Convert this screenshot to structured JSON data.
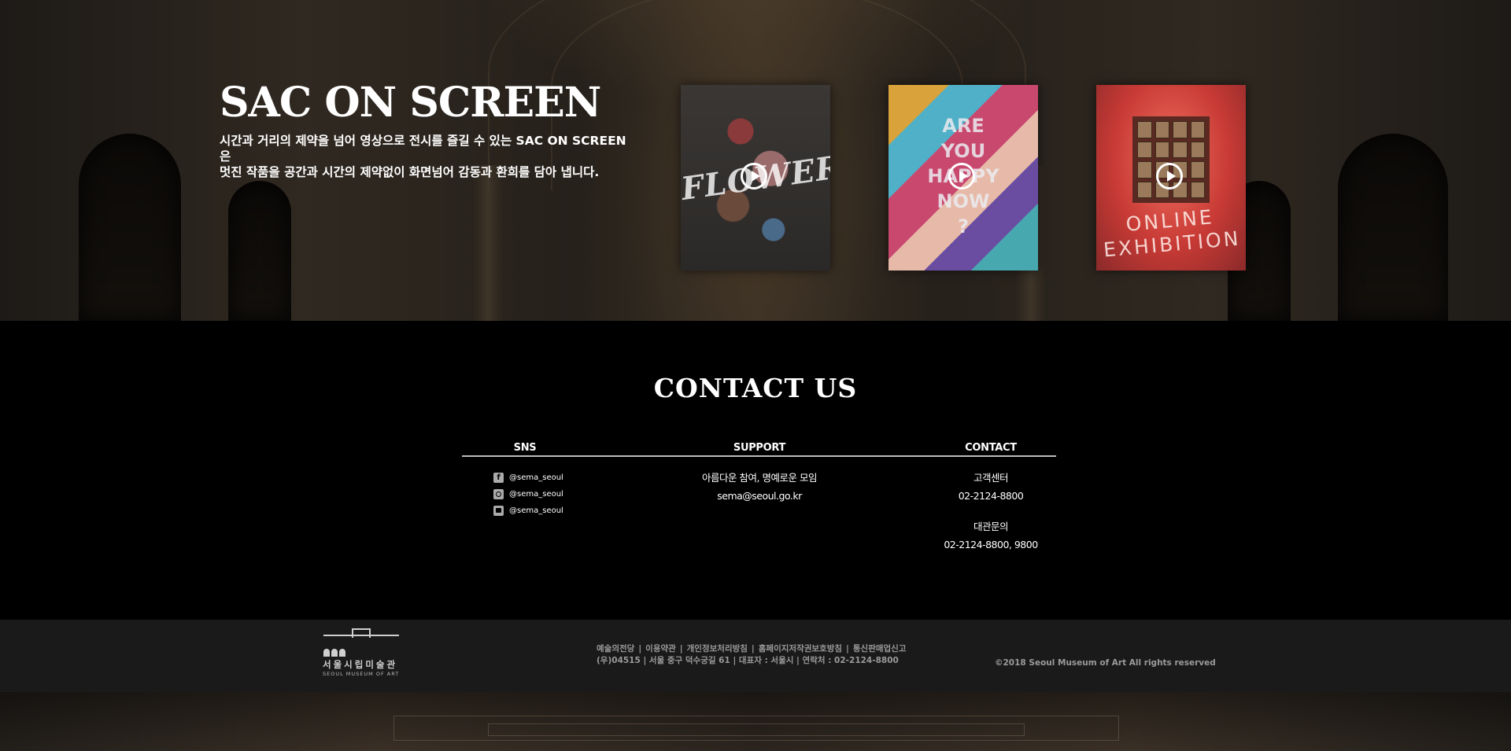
{
  "hero": {
    "title": "SAC ON SCREEN",
    "desc_line1": "시간과 거리의 제약을 넘어 영상으로 전시를 즐길 수 있는 SAC ON SCREEN은",
    "desc_line2": "멋진 작품을 공간과 시간의 제약없이 화면넘어 감동과 환희를 담아 냅니다.",
    "videos": [
      {
        "text": "FLOWER"
      },
      {
        "lines": [
          "ARE",
          "YOU",
          "HAPPY",
          "NOW",
          "?"
        ]
      },
      {
        "lines": [
          "ONLINE",
          "EXHIBITION"
        ]
      }
    ]
  },
  "contact": {
    "title": "CONTACT US",
    "sns": {
      "heading": "SNS",
      "items": [
        {
          "icon": "facebook-icon",
          "label": "@sema_seoul"
        },
        {
          "icon": "instagram-icon",
          "label": "@sema_seoul"
        },
        {
          "icon": "youtube-icon",
          "label": "@sema_seoul"
        }
      ]
    },
    "support": {
      "heading": "SUPPORT",
      "line1": "아름다운 참여, 명예로운 모임",
      "email": "sema@seoul.go.kr"
    },
    "contact_info": {
      "heading": "CONTACT",
      "label1": "고객센터",
      "phone1": "02-2124-8800",
      "label2": "대관문의",
      "phone2": "02-2124-8800, 9800"
    }
  },
  "footer": {
    "logo_ko": "서울시립미술관",
    "logo_en": "SEOUL MUSEUM OF ART",
    "links": [
      "예술의전당",
      "이용약관",
      "개인정보처리방침",
      "홈페이지저작권보호방침",
      "통신판매업신고"
    ],
    "address": "(우)04515  | 서울 중구 덕수궁길 61 | 대표자 : 서울시 | 연락처 : 02-2124-8800",
    "copyright": "©2018 Seoul Museum of Art All rights reserved"
  },
  "colors": {
    "contact_bg": "#000000",
    "footer_bg": "#1a1a1a",
    "footer_text": "#9a9a9a"
  }
}
